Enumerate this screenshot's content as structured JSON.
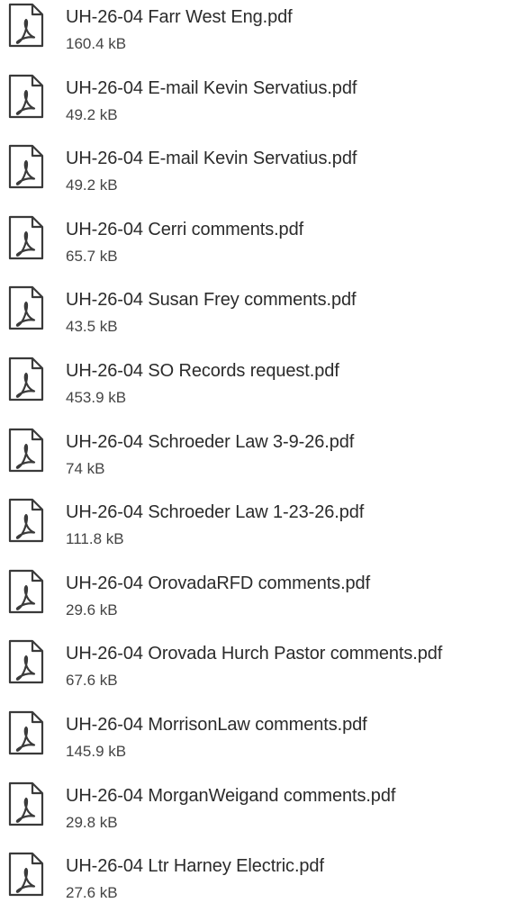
{
  "files": [
    {
      "name": "UH-26-04 Farr West Eng.pdf",
      "size": "160.4 kB",
      "icon": "pdf-file-icon"
    },
    {
      "name": "UH-26-04 E-mail Kevin Servatius.pdf",
      "size": "49.2 kB",
      "icon": "pdf-file-icon"
    },
    {
      "name": "UH-26-04 E-mail Kevin Servatius.pdf",
      "size": "49.2 kB",
      "icon": "pdf-file-icon"
    },
    {
      "name": "UH-26-04 Cerri comments.pdf",
      "size": "65.7 kB",
      "icon": "pdf-file-icon"
    },
    {
      "name": "UH-26-04 Susan Frey comments.pdf",
      "size": "43.5 kB",
      "icon": "pdf-file-icon"
    },
    {
      "name": "UH-26-04 SO Records request.pdf",
      "size": "453.9 kB",
      "icon": "pdf-file-icon"
    },
    {
      "name": "UH-26-04 Schroeder Law 3-9-26.pdf",
      "size": "74 kB",
      "icon": "pdf-file-icon"
    },
    {
      "name": "UH-26-04 Schroeder Law 1-23-26.pdf",
      "size": "111.8 kB",
      "icon": "pdf-file-icon"
    },
    {
      "name": "UH-26-04 OrovadaRFD comments.pdf",
      "size": "29.6 kB",
      "icon": "pdf-file-icon"
    },
    {
      "name": "UH-26-04 Orovada Hurch Pastor comments.pdf",
      "size": "67.6 kB",
      "icon": "pdf-file-icon"
    },
    {
      "name": "UH-26-04 MorrisonLaw comments.pdf",
      "size": "145.9 kB",
      "icon": "pdf-file-icon"
    },
    {
      "name": "UH-26-04 MorganWeigand comments.pdf",
      "size": "29.8 kB",
      "icon": "pdf-file-icon"
    },
    {
      "name": "UH-26-04 Ltr Harney Electric.pdf",
      "size": "27.6 kB",
      "icon": "pdf-file-icon"
    }
  ],
  "colors": {
    "background": "#ffffff",
    "icon_stroke": "#3a3a3a",
    "name_text": "#2b2b2b",
    "size_text": "#444444"
  }
}
